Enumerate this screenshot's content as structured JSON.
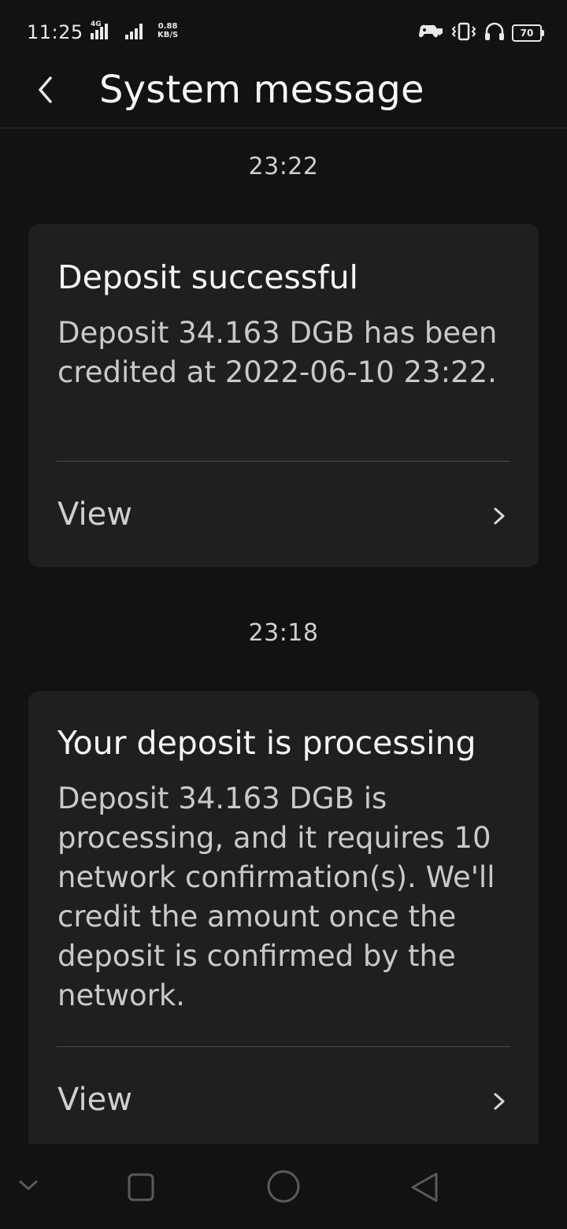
{
  "status_bar": {
    "time": "11:25",
    "network_type": "4G",
    "net_speed_value": "0.88",
    "net_speed_unit": "KB/S",
    "battery_level": "70"
  },
  "header": {
    "title": "System message",
    "back_icon": "chevron-left-icon"
  },
  "messages": [
    {
      "time": "23:22",
      "title": "Deposit successful",
      "body": "Deposit 34.163 DGB has been credited at 2022-06-10 23:22.",
      "action_label": "View"
    },
    {
      "time": "23:18",
      "title": "Your deposit is processing",
      "body": "Deposit 34.163 DGB is processing, and it requires 10 network confirmation(s). We'll credit the amount once the deposit is confirmed by the network.",
      "action_label": "View"
    }
  ],
  "nav_bar": {
    "icons": [
      "chevron-down-icon",
      "square-recents-icon",
      "circle-home-icon",
      "triangle-back-icon"
    ]
  },
  "colors": {
    "background": "#121212",
    "card": "#1f1f1f",
    "title_text": "#f5f5f5",
    "body_text": "#c9c9c9"
  }
}
